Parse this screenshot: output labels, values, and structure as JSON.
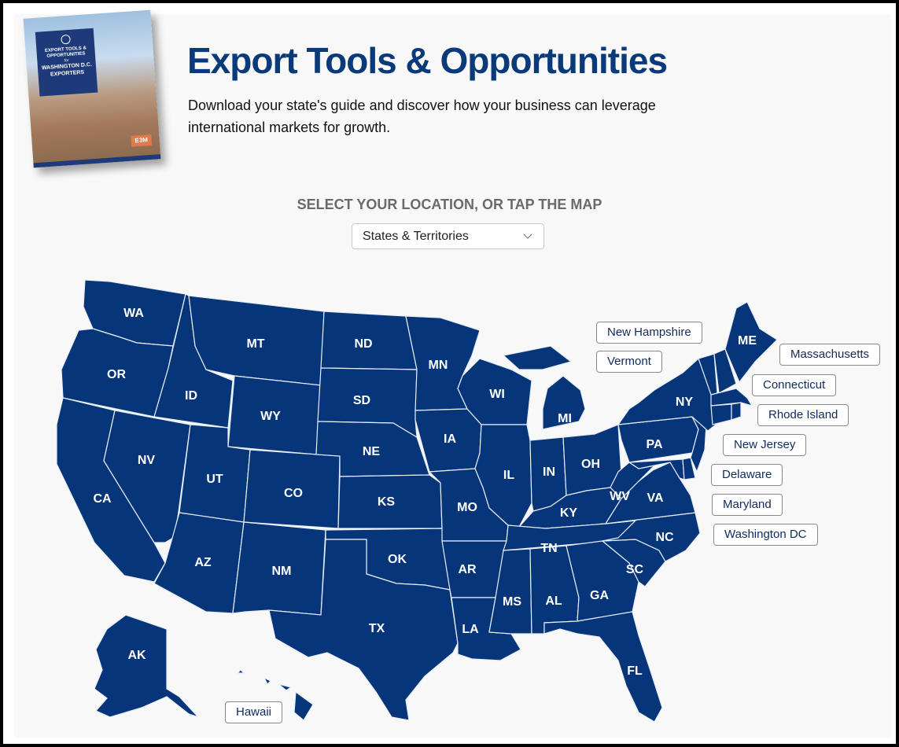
{
  "header": {
    "book_cover": {
      "line1": "EXPORT TOOLS & OPPORTUNITIES",
      "line2": "for",
      "line3": "WASHINGTON D.C. EXPORTERS",
      "logo": "E3M"
    },
    "title": "Export Tools & Opportunities",
    "subtitle": "Download your state's guide and discover how your business can leverage international markets for growth."
  },
  "selector": {
    "prompt": "SELECT YOUR LOCATION, OR TAP THE MAP",
    "selected": "States & Territories"
  },
  "map": {
    "fill_color": "#06357a",
    "state_labels": [
      "WA",
      "OR",
      "CA",
      "ID",
      "NV",
      "MT",
      "WY",
      "UT",
      "AZ",
      "CO",
      "NM",
      "ND",
      "SD",
      "NE",
      "KS",
      "OK",
      "TX",
      "MN",
      "IA",
      "MO",
      "AR",
      "LA",
      "WI",
      "IL",
      "MI",
      "IN",
      "OH",
      "KY",
      "TN",
      "MS",
      "AL",
      "GA",
      "FL",
      "SC",
      "NC",
      "VA",
      "WV",
      "PA",
      "NY",
      "ME",
      "AK"
    ],
    "small_state_buttons": [
      "New Hampshire",
      "Vermont",
      "Massachusetts",
      "Connecticut",
      "Rhode Island",
      "New Jersey",
      "Delaware",
      "Maryland",
      "Washington DC",
      "Hawaii"
    ]
  }
}
